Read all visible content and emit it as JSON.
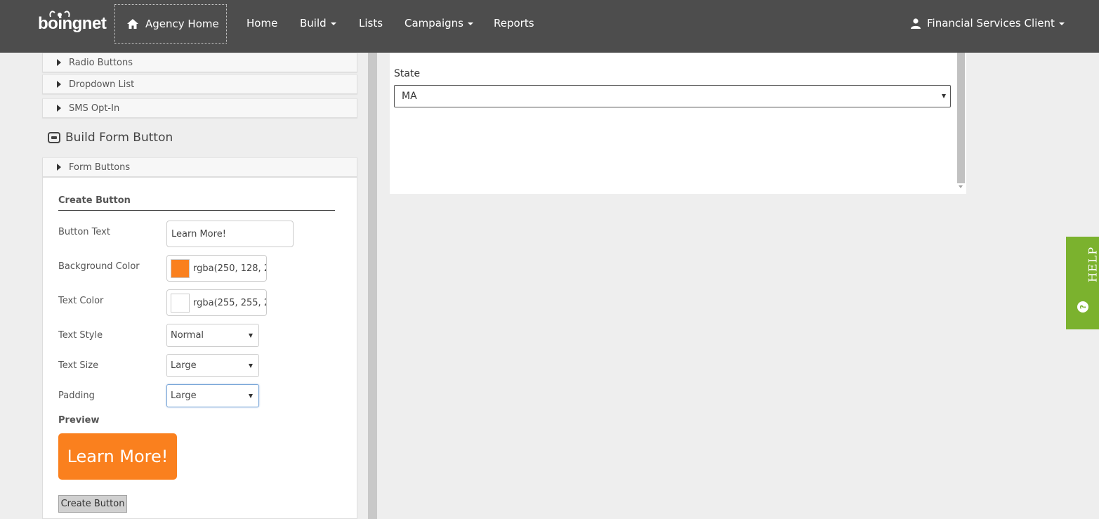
{
  "nav": {
    "logo_text": "boingnet",
    "agency_home": "Agency Home",
    "items": [
      {
        "label": "Home",
        "has_caret": false
      },
      {
        "label": "Build",
        "has_caret": true
      },
      {
        "label": "Lists",
        "has_caret": false
      },
      {
        "label": "Campaigns",
        "has_caret": true
      },
      {
        "label": "Reports",
        "has_caret": false
      }
    ],
    "user": "Financial Services Client"
  },
  "sidebar": {
    "accordion_top": [
      "Radio Buttons",
      "Dropdown List",
      "SMS Opt-In"
    ],
    "section_title": "Build Form Button",
    "form_buttons_label": "Form Buttons",
    "create": {
      "heading": "Create Button",
      "button_text_label": "Button Text",
      "button_text_value": "Learn More!",
      "bg_color_label": "Background Color",
      "bg_color_value": "rgba(250, 128, 2",
      "bg_swatch": "#fa801e",
      "text_color_label": "Text Color",
      "text_color_value": "rgba(255, 255, 2",
      "text_swatch": "#ffffff",
      "text_style_label": "Text Style",
      "text_style_value": "Normal",
      "text_size_label": "Text Size",
      "text_size_value": "Large",
      "padding_label": "Padding",
      "padding_value": "Large",
      "preview_label": "Preview",
      "preview_button": "Learn More!",
      "create_button": "Create Button"
    }
  },
  "preview_pane": {
    "state_label": "State",
    "state_value": "MA"
  },
  "help": {
    "label": "HELP",
    "icon": "question-icon"
  },
  "colors": {
    "nav_bg": "#4d4d4d",
    "accent_orange": "#fa801e",
    "help_green": "#7bb22e"
  }
}
